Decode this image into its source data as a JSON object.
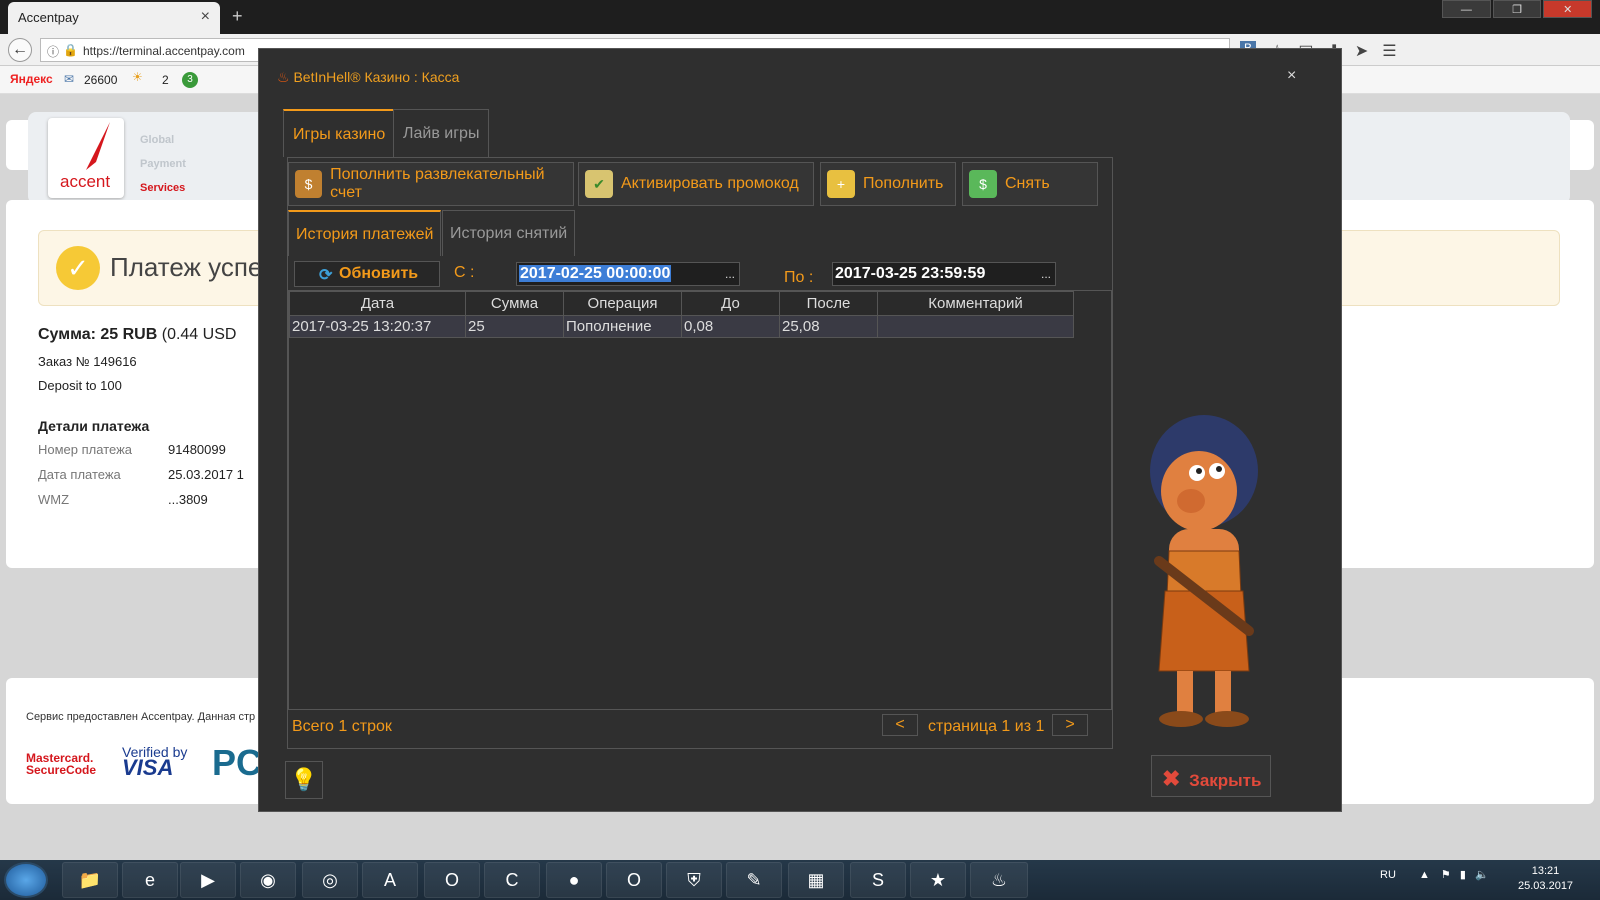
{
  "browser": {
    "tab_title": "Accentpay",
    "url": "https://terminal.accentpay.com",
    "bookmarks": {
      "yandex": "Яндекс",
      "mail_count": "26600",
      "weather": "2",
      "badge": "3"
    }
  },
  "page": {
    "logo": "accent",
    "gps": [
      "Global",
      "Payment",
      "Services"
    ],
    "success_text": "Платеж успе",
    "sum_label": "Сумма: 25 RUB",
    "sum_usd": "(0.44 USD",
    "order": "Заказ № 149616",
    "deposit": "Deposit to 100",
    "details_title": "Детали платежа",
    "details": [
      {
        "label": "Номер платежа",
        "value": "91480099"
      },
      {
        "label": "Дата платежа",
        "value": "25.03.2017 1"
      },
      {
        "label": "WMZ",
        "value": "...3809"
      }
    ],
    "footer_text": "Сервис предоставлен Accentpay. Данная стр",
    "mastercard": [
      "Mastercard.",
      "SecureCode"
    ],
    "visa": [
      "Verified by",
      "VISA"
    ],
    "pci": "PC"
  },
  "modal": {
    "title": "BetInHell® Казино : Касса",
    "close": "×",
    "tabs": [
      "Игры казино",
      "Лайв игры"
    ],
    "actions": {
      "deposit_fun": "Пополнить развлекательный счет",
      "promo": "Активировать промокод",
      "topup": "Пополнить",
      "withdraw": "Снять"
    },
    "subtabs": [
      "История платежей",
      "История снятий"
    ],
    "refresh": "Обновить",
    "from_label": "С :",
    "from_value": "2017-02-25 00:00:00",
    "to_label": "По :",
    "to_value": "2017-03-25 23:59:59",
    "dots": "...",
    "columns": [
      "Дата",
      "Сумма",
      "Операция",
      "До",
      "После",
      "Комментарий"
    ],
    "rows": [
      [
        "2017-03-25 13:20:37",
        "25",
        "Пополнение",
        "0,08",
        "25,08",
        ""
      ]
    ],
    "total": "Всего 1 строк",
    "page_info": "страница 1 из 1",
    "prev": "<",
    "next": ">",
    "close_button": "Закрыть"
  },
  "taskbar": {
    "lang": "RU",
    "time": "13:21",
    "date": "25.03.2017"
  }
}
